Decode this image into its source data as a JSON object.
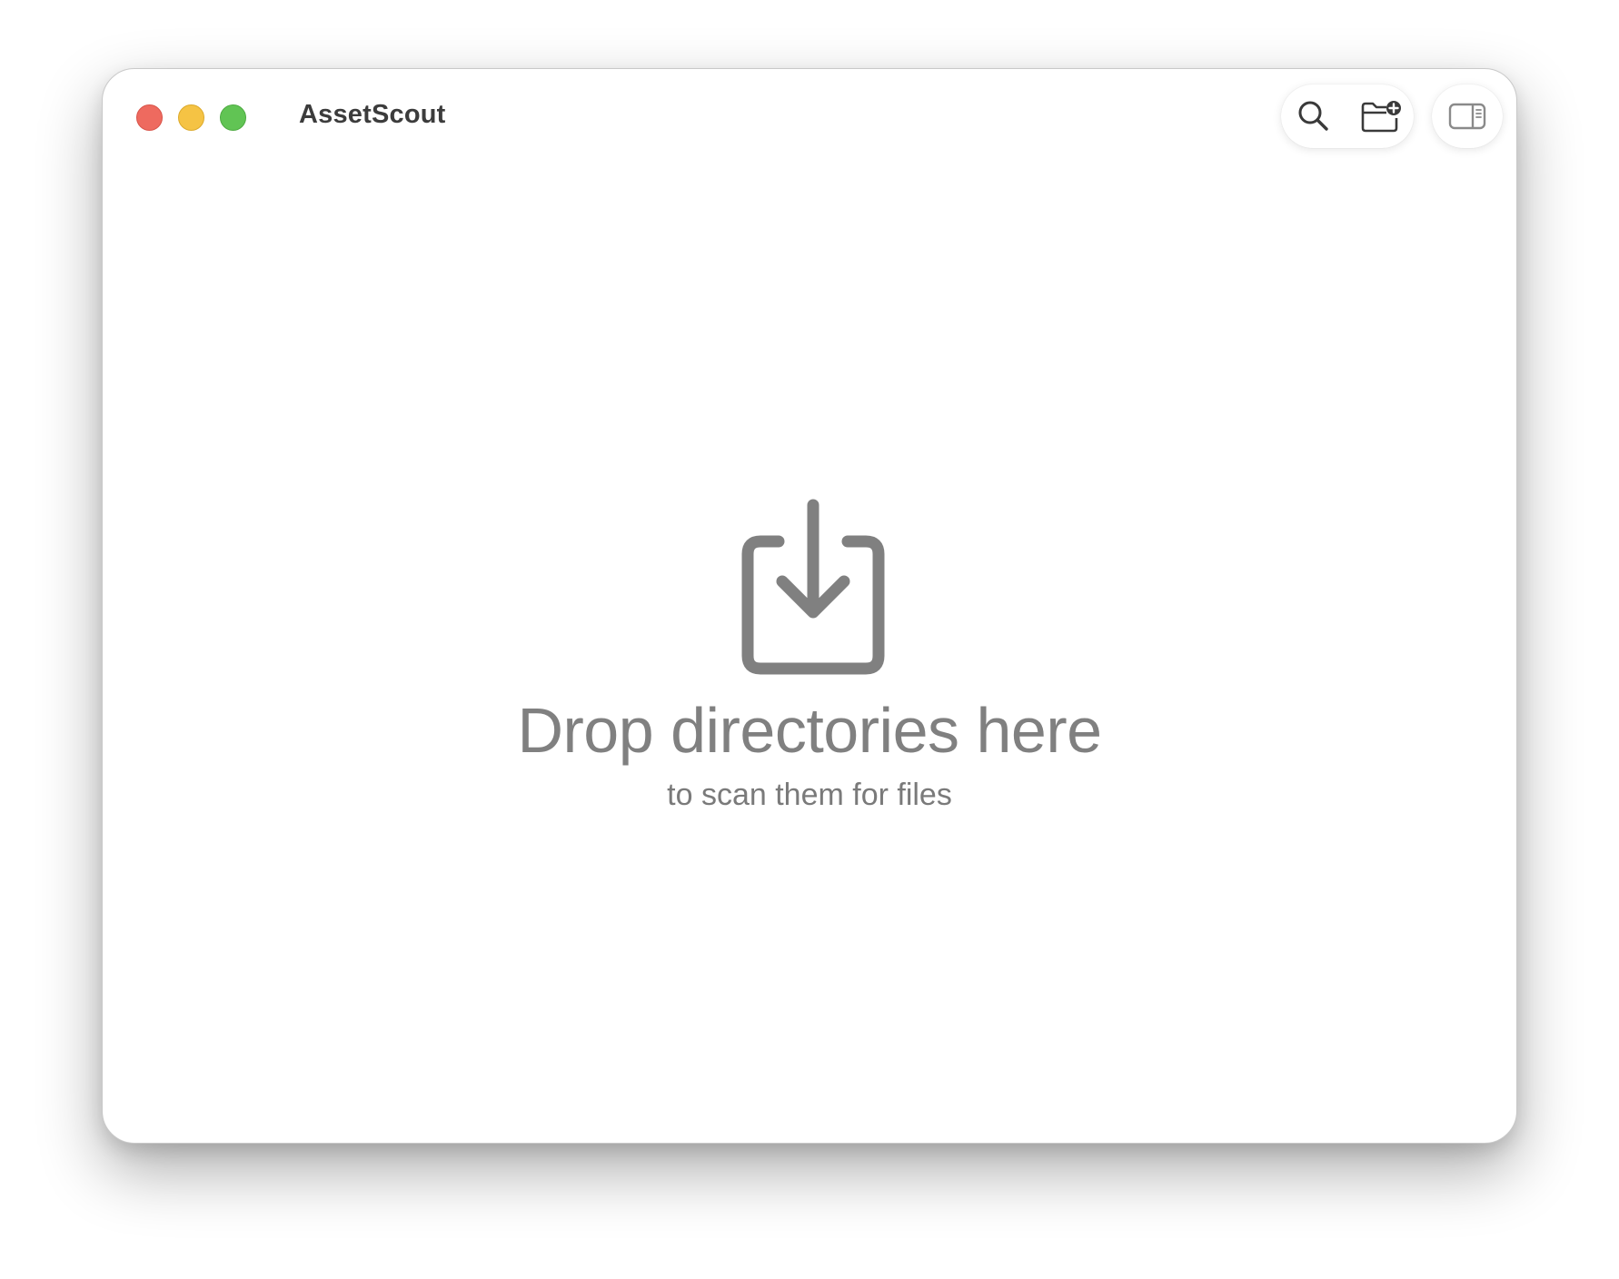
{
  "window": {
    "title": "AssetScout"
  },
  "traffic_lights": {
    "close_color": "#ee6a5f",
    "minimize_color": "#f5c344",
    "zoom_color": "#61c454"
  },
  "toolbar": {
    "items": [
      {
        "name": "search",
        "icon": "magnifying-glass-icon"
      },
      {
        "name": "add-folder",
        "icon": "folder-badge-plus-icon"
      },
      {
        "name": "toggle-inspector",
        "icon": "sidebar-right-icon"
      }
    ]
  },
  "drop_zone": {
    "icon": "square-arrow-down-icon",
    "title": "Drop directories here",
    "subtitle": "to scan them for files"
  }
}
